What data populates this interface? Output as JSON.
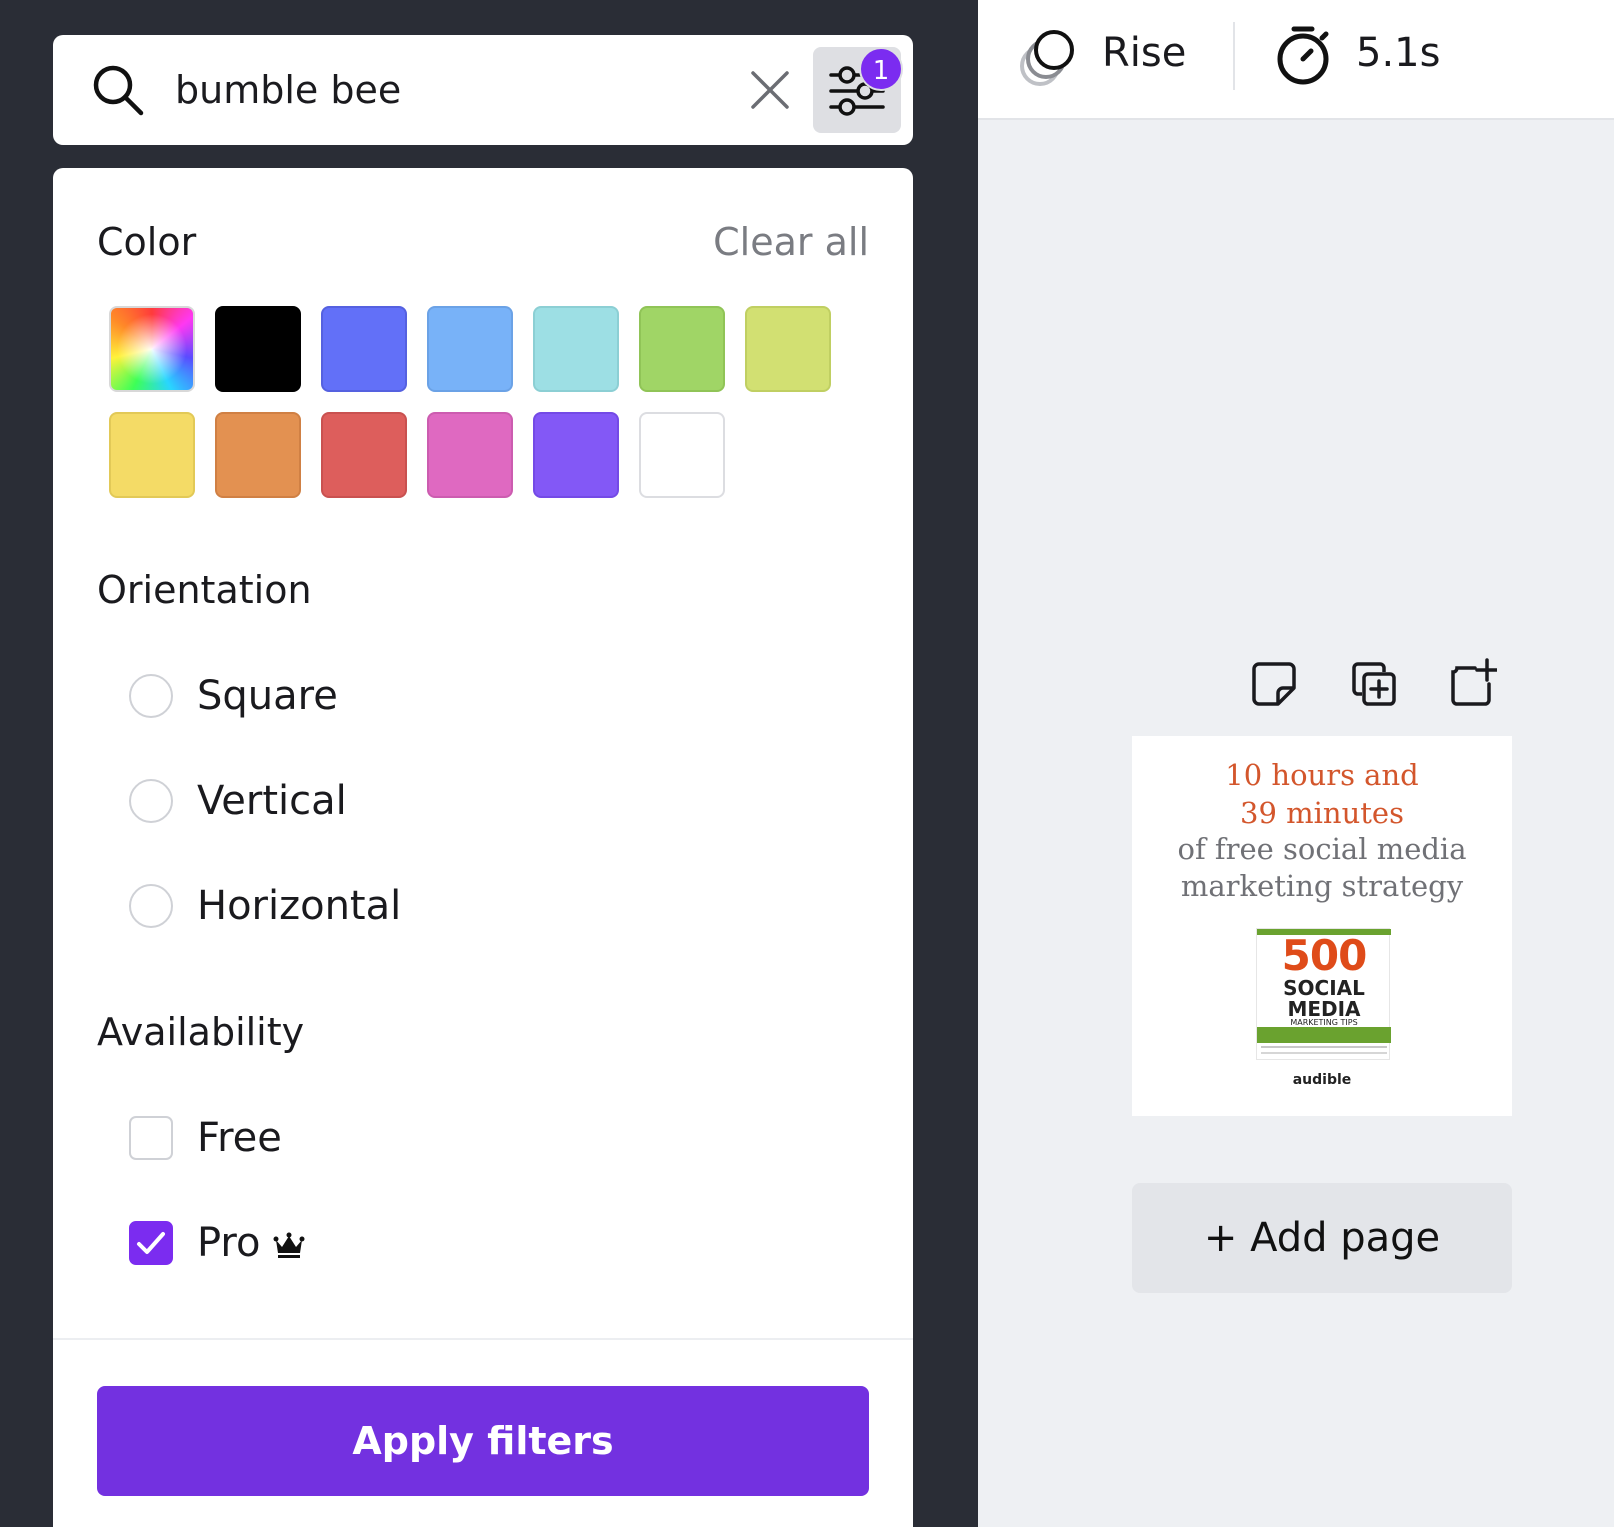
{
  "search": {
    "query": "bumble bee",
    "active_filter_count": "1"
  },
  "filters": {
    "color_title": "Color",
    "clear_all": "Clear all",
    "colors": [
      "rainbow",
      "#000000",
      "#6270f8",
      "#78b2f8",
      "#9ddfe4",
      "#a0d566",
      "#d2e072",
      "#f4db66",
      "#e39151",
      "#dd5e5c",
      "#df69c1",
      "#8358f6",
      "#ffffff"
    ],
    "orientation_title": "Orientation",
    "orientation_options": [
      "Square",
      "Vertical",
      "Horizontal"
    ],
    "availability_title": "Availability",
    "availability_options": [
      {
        "label": "Free",
        "checked": false
      },
      {
        "label": "Pro",
        "checked": true
      }
    ],
    "apply_label": "Apply filters"
  },
  "toolbar": {
    "animation_label": "Rise",
    "duration_label": "5.1s"
  },
  "page_thumbnail": {
    "line1": "10 hours and",
    "line2": "39 minutes",
    "line3": "of free social media",
    "line4": "marketing strategy",
    "book_number": "500",
    "book_line1": "SOCIAL",
    "book_line2": "MEDIA",
    "book_line3": "MARKETING TIPS",
    "brand": "audible"
  },
  "add_page_label": "+ Add page",
  "accent_color": "#7331e0"
}
